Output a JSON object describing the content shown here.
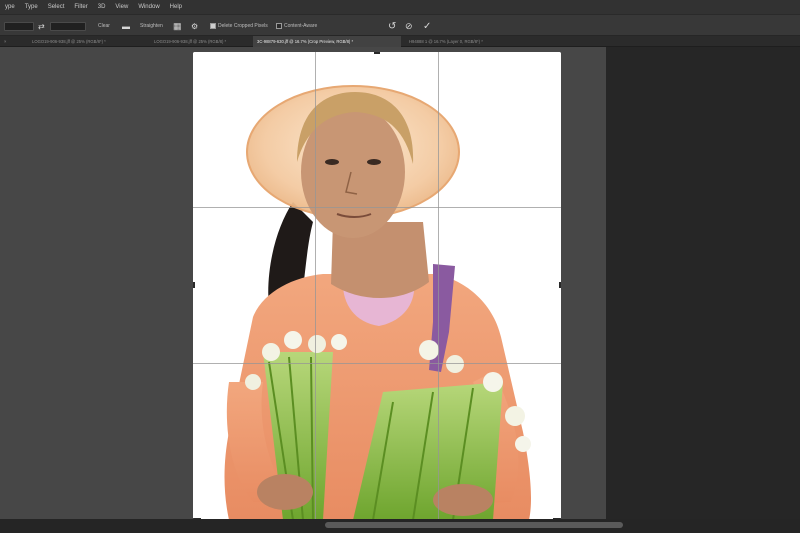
{
  "menu": [
    "ype",
    "Type",
    "Select",
    "Filter",
    "3D",
    "View",
    "Window",
    "Help"
  ],
  "options": {
    "ratio_value": "",
    "clear_label": "Clear",
    "straighten_label": "Straighten",
    "delete_cropped_label": "Delete Cropped Pixels",
    "content_aware_label": "Content-Aware",
    "delete_cropped_checked": true,
    "content_aware_checked": false
  },
  "tabs": [
    {
      "label": "×",
      "active": false
    },
    {
      "label": "LOGO19-906-938.jff @ 25% (RGB/8*) *",
      "active": false
    },
    {
      "label": "LOGO19-906-938.jff @ 25% (RGB/8) *",
      "active": false
    },
    {
      "label": "3C-98879-630.jff @ 16.7% (Crop Preview, RGB/8) *",
      "active": true
    },
    {
      "label": "H94888 1 @ 16.7% (Layer 0, RGB/8*) *",
      "active": false
    }
  ],
  "status": {
    "zoom": "",
    "info": ""
  },
  "colors": {
    "hat": "#f3c9a0",
    "shirt": "#ee9b72",
    "skin": "#c4906f",
    "hair": "#c9a067",
    "strap": "#8a5aa0",
    "greens": "#8fbf3f"
  }
}
